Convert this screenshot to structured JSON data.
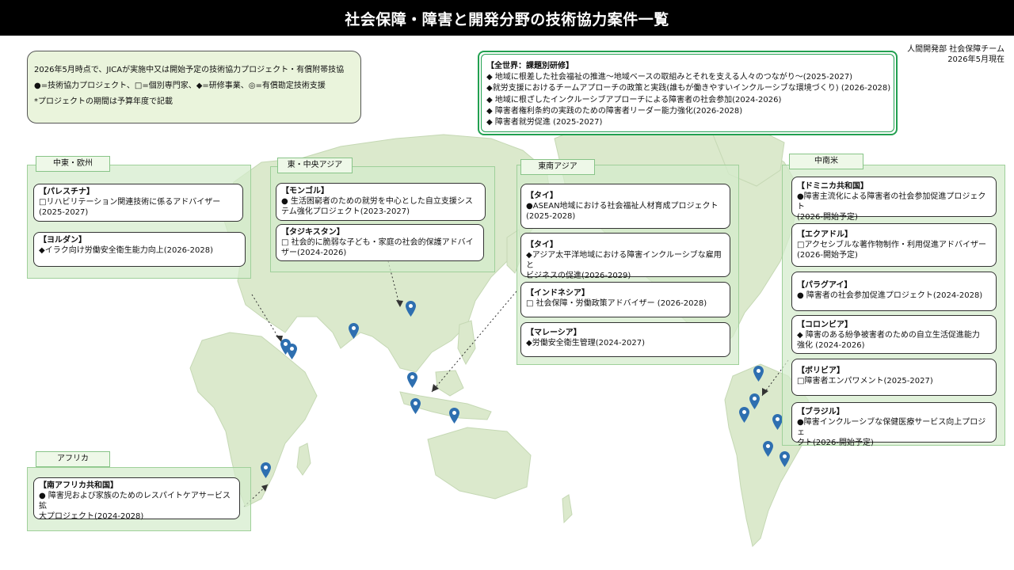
{
  "title": "社会保障・障害と開発分野の技術協力案件一覧",
  "department": [
    "人間開発部 社会保障チーム",
    "2026年5月現在"
  ],
  "legend": [
    "2026年5月時点で、JICAが実施中又は開始予定の技術協力プロジェクト・有償附帯技協",
    "●=技術協力プロジェクト、□=個別専門家、◆=研修事業、◎=有償勘定技術支援",
    "*プロジェクトの期間は予算年度で記載"
  ],
  "global": {
    "header": "【全世界：課題別研修】",
    "items": [
      "◆ 地域に根差した社会福祉の推進～地域ベースの取組みとそれを支える人々のつながり～(2025-2027)",
      "◆就労支援におけるチームアプローチの政策と実践(誰もが働きやすいインクルーシブな環境づくり) (2026-2028)",
      "◆ 地域に根ざしたインクルーシブアプローチによる障害者の社会参加(2024-2026)",
      "◆ 障害者権利条約の実践のための障害者リーダー能力強化(2026-2028)",
      "◆ 障害者就労促進 (2025-2027)"
    ]
  },
  "regions": {
    "middle_east": {
      "label": "中東・欧州",
      "cards": [
        {
          "country": "【パレスチナ】",
          "lines": [
            "□リハビリテーション関連技術に係るアドバイザー",
            "(2025-2027)"
          ]
        },
        {
          "country": "【ヨルダン】",
          "lines": [
            "◆イラク向け労働安全衛生能力向上(2026-2028)"
          ]
        }
      ]
    },
    "east_asia": {
      "label": "東・中央アジア",
      "cards": [
        {
          "country": "【モンゴル】",
          "lines": [
            "● 生活困窮者のための就労を中心とした自立支援シス",
            "テム強化プロジェクト(2023-2027)"
          ]
        },
        {
          "country": "【タジキスタン】",
          "lines": [
            "□ 社会的に脆弱な子ども・家庭の社会的保護アドバイ",
            "ザー(2024-2026)"
          ]
        }
      ]
    },
    "southeast_asia": {
      "label": "東南アジア",
      "cards": [
        {
          "country": "【タイ】",
          "lines": [
            "●ASEAN地域における社会福祉人材育成プロジェクト",
            "(2025-2028)"
          ]
        },
        {
          "country": "【タイ】",
          "lines": [
            "◆アジア太平洋地域における障害インクルーシブな雇用と",
            "ビジネスの促進(2026-2029)"
          ]
        },
        {
          "country": "【インドネシア】",
          "lines": [
            "□ 社会保障・労働政策アドバイザー (2026-2028)"
          ]
        },
        {
          "country": "【マレーシア】",
          "lines": [
            "◆労働安全衛生管理(2024-2027)"
          ]
        }
      ]
    },
    "latin_america": {
      "label": "中南米",
      "cards": [
        {
          "country": "【ドミニカ共和国】",
          "lines": [
            "●障害主流化による障害者の社会参加促進プロジェクト",
            "(2026-開始予定)"
          ]
        },
        {
          "country": "【エクアドル】",
          "lines": [
            "□アクセシブルな著作物制作・利用促進アドバイザー",
            "(2026-開始予定)"
          ]
        },
        {
          "country": "【パラグアイ】",
          "lines": [
            "● 障害者の社会参加促進プロジェクト(2024-2028)"
          ]
        },
        {
          "country": "【コロンビア】",
          "lines": [
            "◆ 障害のある紛争被害者のための自立生活促進能力",
            "強化 (2024-2026)"
          ]
        },
        {
          "country": "【ボリビア】",
          "lines": [
            "□障害者エンパワメント(2025-2027)"
          ]
        },
        {
          "country": "【ブラジル】",
          "lines": [
            "●障害インクルーシブな保健医療サービス向上プロジェ",
            "クト(2026-開始予定)"
          ]
        }
      ]
    },
    "africa": {
      "label": "アフリカ",
      "cards": [
        {
          "country": "【南アフリカ共和国】",
          "lines": [
            "● 障害児および家族のためのレスパイトケアサービス拡",
            "大プロジェクト(2024-2028)"
          ]
        }
      ]
    }
  },
  "colors": {
    "land": "#dbe9cc",
    "land_edge": "#c5d8b4",
    "region": "#d4eccc",
    "pin": "#2e6fb0",
    "global_border": "#22a050"
  }
}
